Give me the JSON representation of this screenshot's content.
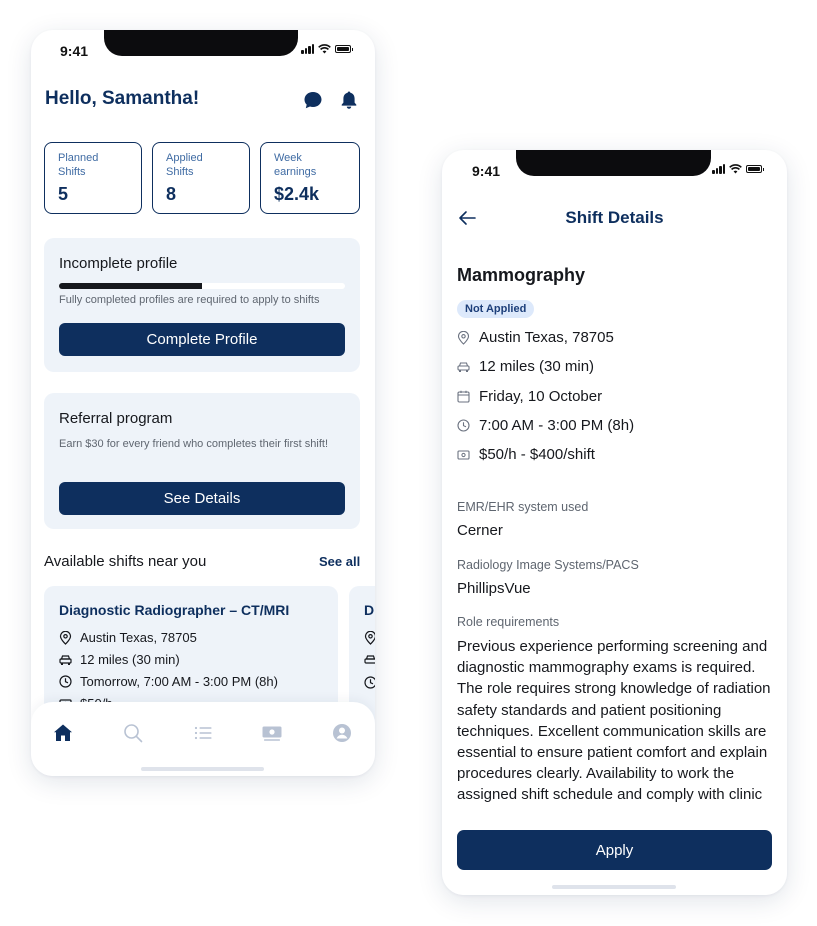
{
  "colors": {
    "navy": "#0e2f5e",
    "card_bg": "#eef3f9",
    "badge_bg": "#dde9fb",
    "link_blue": "#3f6ba3"
  },
  "home": {
    "status_time": "9:41",
    "greeting": "Hello, Samantha!",
    "header_icons": [
      "chat-bubble-icon",
      "bell-icon"
    ],
    "stats": [
      {
        "label": "Planned\nShifts",
        "value": "5"
      },
      {
        "label": "Applied\nShifts",
        "value": "8"
      },
      {
        "label": "Week\nearnings",
        "value": "$2.4k"
      }
    ],
    "profile_card": {
      "title": "Incomplete profile",
      "progress": 0.5,
      "note": "Fully completed profiles are required to apply to shifts",
      "button": "Complete Profile"
    },
    "referral_card": {
      "title": "Referral program",
      "note": "Earn $30 for every friend who completes their first shift!",
      "button": "See Details"
    },
    "available_title": "Available shifts near you",
    "see_all": "See all",
    "shift_cards": [
      {
        "title": "Diagnostic Radiographer – CT/MRI",
        "location": "Austin Texas, 78705",
        "distance": "12 miles (30 min)",
        "time": "Tomorrow, 7:00 AM - 3:00 PM (8h)",
        "pay": "$50/h"
      },
      {
        "title": "D"
      }
    ],
    "tabs": [
      "home-icon",
      "search-icon",
      "list-icon",
      "money-icon",
      "profile-icon"
    ],
    "active_tab": "home-icon"
  },
  "details": {
    "status_time": "9:41",
    "header_title": "Shift Details",
    "title": "Mammography",
    "badge": "Not Applied",
    "location": "Austin Texas, 78705",
    "distance": "12 miles (30 min)",
    "date": "Friday, 10 October",
    "time": "7:00 AM - 3:00 PM (8h)",
    "pay": "$50/h - $400/shift",
    "emr_label": "EMR/EHR system used",
    "emr_value": "Cerner",
    "pacs_label": "Radiology Image Systems/PACS",
    "pacs_value": "PhillipsVue",
    "req_label": "Role requirements",
    "req_text": "Previous experience performing screening and diagnostic mammography exams is required. The role requires strong knowledge of radiation safety standards and patient positioning techniques. Excellent communication skills are essential to ensure patient comfort and explain procedures clearly. Availability to work the assigned shift schedule and comply with clinic",
    "apply_button": "Apply"
  }
}
